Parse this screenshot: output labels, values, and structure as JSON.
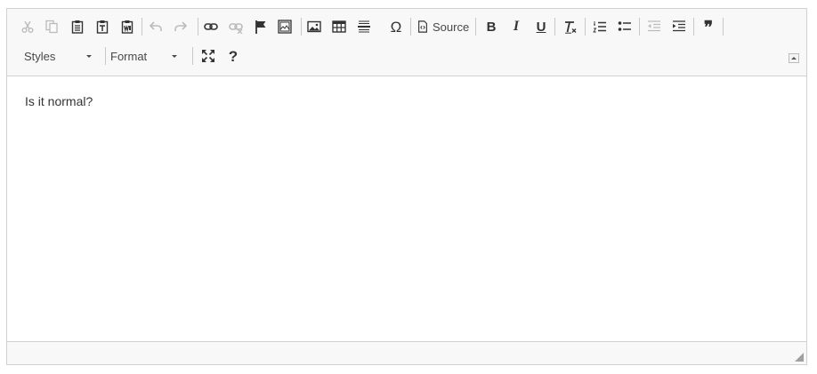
{
  "editor": {
    "toolbar": {
      "row1": [
        {
          "name": "cut-icon",
          "enabled": false
        },
        {
          "name": "copy-icon",
          "enabled": false
        },
        {
          "name": "paste-icon",
          "enabled": true
        },
        {
          "name": "paste-text-icon",
          "enabled": true
        },
        {
          "name": "paste-from-word-icon",
          "enabled": true
        },
        {
          "name": "undo-icon",
          "enabled": false
        },
        {
          "name": "redo-icon",
          "enabled": false
        },
        {
          "name": "link-icon",
          "enabled": true
        },
        {
          "name": "unlink-icon",
          "enabled": false
        },
        {
          "name": "anchor-icon",
          "enabled": true
        },
        {
          "name": "iframe-icon",
          "enabled": true
        },
        {
          "name": "image-icon",
          "enabled": true
        },
        {
          "name": "table-icon",
          "enabled": true
        },
        {
          "name": "horizontal-line-icon",
          "enabled": true
        },
        {
          "name": "special-char-icon",
          "enabled": true
        },
        {
          "name": "source-icon",
          "enabled": true
        },
        {
          "name": "bold-icon",
          "enabled": true
        },
        {
          "name": "italic-icon",
          "enabled": true
        },
        {
          "name": "underline-icon",
          "enabled": true
        },
        {
          "name": "remove-format-icon",
          "enabled": true
        },
        {
          "name": "numbered-list-icon",
          "enabled": true
        },
        {
          "name": "bulleted-list-icon",
          "enabled": true
        },
        {
          "name": "decrease-indent-icon",
          "enabled": false
        },
        {
          "name": "increase-indent-icon",
          "enabled": true
        },
        {
          "name": "blockquote-icon",
          "enabled": true
        }
      ],
      "source_label": "Source",
      "bold_glyph": "B",
      "italic_glyph": "I",
      "underline_glyph": "U",
      "special_char_glyph": "Ω",
      "blockquote_glyph": "❞",
      "styles_label": "Styles",
      "format_label": "Format",
      "help_glyph": "?"
    },
    "content_text": "Is it normal?",
    "colors": {
      "toolbar_bg": "#f8f8f8",
      "border": "#d1d1d1",
      "icon": "#333333"
    }
  }
}
